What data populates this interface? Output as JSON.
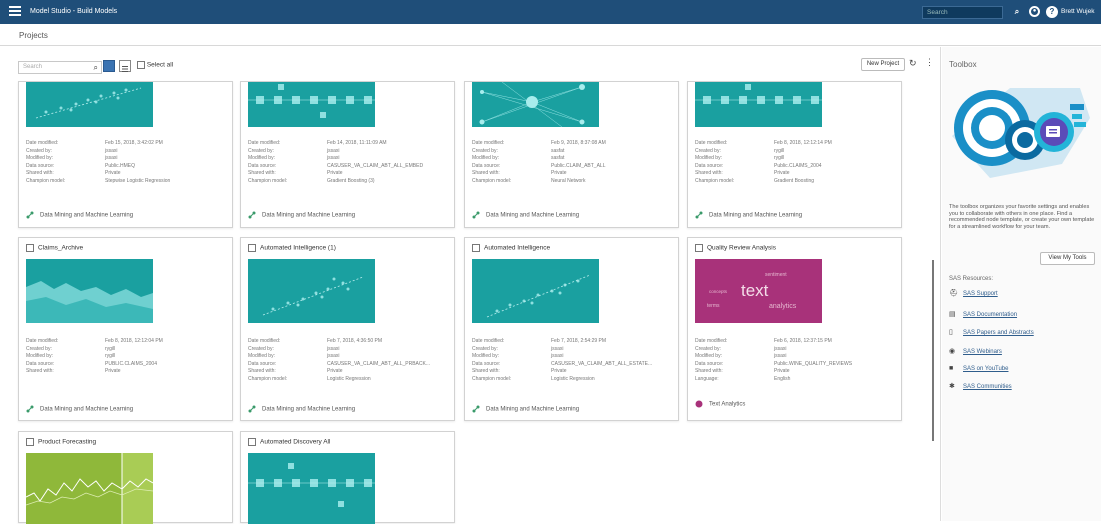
{
  "topbar": {
    "title": "Model Studio - Build Models",
    "search_placeholder": "Search",
    "user": "Brett Wujek"
  },
  "header": {
    "title": "Projects"
  },
  "toolbar": {
    "search_placeholder": "Search",
    "select_all": "Select all",
    "new_project": "New Project"
  },
  "labels": {
    "date_modified": "Date modified:",
    "created_by": "Created by:",
    "modified_by": "Modified by:",
    "data_source": "Data source:",
    "shared_with": "Shared with:",
    "champion_model": "Champion model:",
    "language": "Language:"
  },
  "row1": [
    {
      "date": "Feb 15, 2018, 3:42:02 PM",
      "created": "jssaxi",
      "modified": "jssaxi",
      "source": "Public.HMEQ",
      "shared": "Private",
      "champion": "Stepwise Logistic Regression",
      "footer": "Data Mining and Machine Learning"
    },
    {
      "date": "Feb 14, 2018, 11:11:09 AM",
      "created": "jssaxi",
      "modified": "jssaxi",
      "source": "CASUSER_VA_CLAIM_ABT_ALL_EMBED",
      "shared": "Private",
      "champion": "Gradient Boosting (3)",
      "footer": "Data Mining and Machine Learning"
    },
    {
      "date": "Feb 9, 2018, 8:37:08 AM",
      "created": "sasfat",
      "modified": "sasfat",
      "source": "Public.CLAIM_ABT_ALL",
      "shared": "Private",
      "champion": "Neural Network",
      "footer": "Data Mining and Machine Learning"
    },
    {
      "date": "Feb 8, 2018, 12:12:14 PM",
      "created": "rygill",
      "modified": "rygill",
      "source": "Public.CLAIMS_2004",
      "shared": "Private",
      "champion": "Gradient Boosting",
      "footer": "Data Mining and Machine Learning"
    }
  ],
  "row2": [
    {
      "title": "Claims_Archive",
      "date": "Feb 8, 2018, 12:12:04 PM",
      "created": "rygill",
      "modified": "rygill",
      "source": "PUBLIC.CLAIMS_2004",
      "shared": "Private",
      "footer": "Data Mining and Machine Learning"
    },
    {
      "title": "Automated Intelligence (1)",
      "date": "Feb 7, 2018, 4:36:50 PM",
      "created": "jssaxi",
      "modified": "jssaxi",
      "source": "CASUSER_VA_CLAIM_ABT_ALL_PRBACK...",
      "shared": "Private",
      "champion": "Logistic Regression",
      "footer": "Data Mining and Machine Learning"
    },
    {
      "title": "Automated Intelligence",
      "date": "Feb 7, 2018, 2:54:29 PM",
      "created": "jssaxi",
      "modified": "jssaxi",
      "source": "CASUSER_VA_CLAIM_ABT_ALL_ESTATE...",
      "shared": "Private",
      "champion": "Logistic Regression",
      "footer": "Data Mining and Machine Learning"
    },
    {
      "title": "Quality Review Analysis",
      "date": "Feb 6, 2018, 12:37:15 PM",
      "created": "jssaxi",
      "modified": "jssaxi",
      "source": "Public.WINE_QUALITY_REVIEWS",
      "shared": "Private",
      "language": "English",
      "footer": "Text Analytics",
      "words": {
        "main": "text",
        "w1": "sentiment",
        "w2": "analytics",
        "w3": "terms",
        "w4": "concepts"
      }
    }
  ],
  "row3": [
    {
      "title": "Product Forecasting"
    },
    {
      "title": "Automated Discovery All"
    }
  ],
  "toolbox": {
    "title": "Toolbox",
    "description": "The toolbox organizes your favorite settings and enables you to collaborate with others in one place. Find a recommended node template, or create your own template for a streamlined workflow for your team.",
    "button": "View My Tools",
    "resources_title": "SAS Resources:",
    "resources": [
      "SAS Support",
      "SAS Documentation",
      "SAS Papers and Abstracts",
      "SAS Webinars",
      "SAS on YouTube",
      "SAS Communities"
    ]
  },
  "colors": {
    "topbar": "#1f4e79",
    "accent": "#3a73b2",
    "teal": "#1aa0a0",
    "magenta": "#a8327a",
    "green": "#8fb83a"
  }
}
